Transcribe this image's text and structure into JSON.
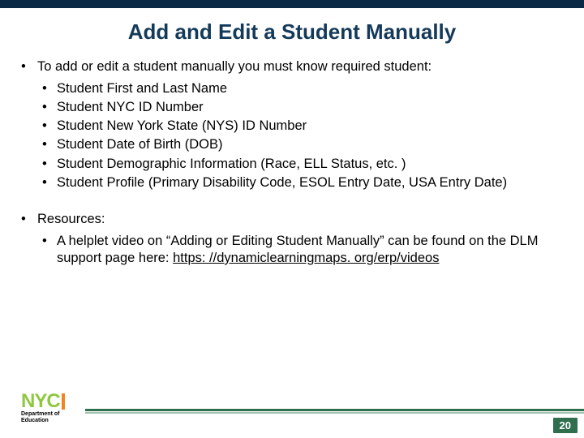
{
  "title": "Add and Edit a Student Manually",
  "intro": "To add or edit a student manually you must know required student:",
  "req": [
    "Student First and Last Name",
    "Student NYC ID Number",
    "Student New York State (NYS) ID Number",
    "Student Date of Birth (DOB)",
    "Student Demographic Information (Race, ELL Status, etc. )",
    "Student Profile (Primary Disability Code, ESOL Entry Date, USA Entry Date)"
  ],
  "resources_label": "Resources:",
  "resources_text": "A helplet video on “Adding or Editing Student Manually” can be found on the DLM support page here: ",
  "resources_link": "https: //dynamiclearningmaps. org/erp/videos",
  "logo": {
    "brand": "NYC",
    "line1": "Department of",
    "line2": "Education"
  },
  "page_number": "20"
}
